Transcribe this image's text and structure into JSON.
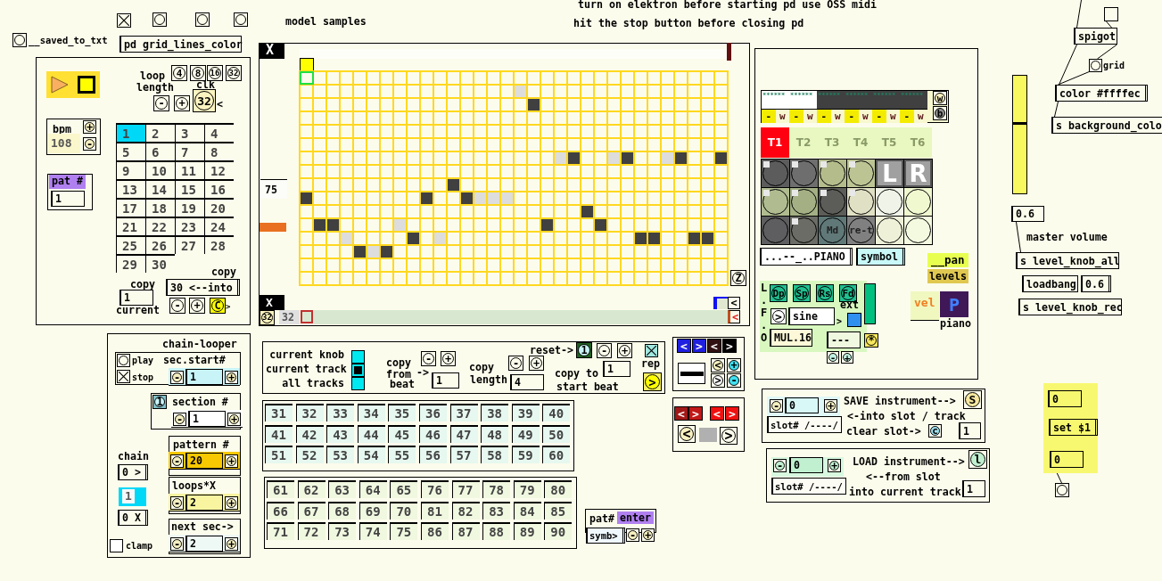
{
  "header": {
    "saved_label": "__saved_to_txt",
    "toggle_checked": true,
    "subpatch": "pd grid_lines_color"
  },
  "comments": [
    "model samples",
    "turn on elektron before starting pd use OSS midi",
    "hit the stop button before closing pd"
  ],
  "transport": {
    "loop_label": "loop",
    "length_label": "length",
    "loop_buttons": [
      "4",
      "8",
      "16",
      "32"
    ],
    "clk_label": "clk",
    "minus": "-",
    "plus": "+",
    "clk_value": "32",
    "clk_arrow": "<",
    "bpm_label": "bpm",
    "bpm_plus": "+",
    "bpm": "108",
    "bpm_minus": "-",
    "pat_label": "pat #",
    "pat_value": "1",
    "patterns": [
      {
        "label": "1",
        "selected": true
      },
      {
        "label": "2",
        "selected": false
      },
      {
        "label": "3",
        "selected": false
      },
      {
        "label": "4",
        "selected": false
      },
      {
        "label": "5",
        "selected": false
      },
      {
        "label": "6",
        "selected": false
      },
      {
        "label": "7",
        "selected": false
      },
      {
        "label": "8",
        "selected": false
      },
      {
        "label": "9",
        "selected": false
      },
      {
        "label": "10",
        "selected": false
      },
      {
        "label": "11",
        "selected": false
      },
      {
        "label": "12",
        "selected": false
      },
      {
        "label": "13",
        "selected": false
      },
      {
        "label": "14",
        "selected": false
      },
      {
        "label": "15",
        "selected": false
      },
      {
        "label": "16",
        "selected": false
      },
      {
        "label": "17",
        "selected": false
      },
      {
        "label": "18",
        "selected": false
      },
      {
        "label": "19",
        "selected": false
      },
      {
        "label": "20",
        "selected": false
      },
      {
        "label": "21",
        "selected": false
      },
      {
        "label": "22",
        "selected": false
      },
      {
        "label": "23",
        "selected": false
      },
      {
        "label": "24",
        "selected": false
      },
      {
        "label": "25",
        "selected": false
      },
      {
        "label": "26",
        "selected": false
      },
      {
        "label": "27",
        "selected": false
      },
      {
        "label": "28",
        "selected": false
      },
      {
        "label": "29",
        "selected": false
      },
      {
        "label": "30",
        "selected": false
      }
    ],
    "copy_label": "copy",
    "copy_value": "1",
    "current_label": "current",
    "into_label": "copy",
    "into_message": "30 <--into",
    "into_minus": "-",
    "into_plus": "+",
    "copy_button": "C",
    "copy_arrow": ">"
  },
  "chain_looper": {
    "title": "chain-looper",
    "play_label": "play",
    "stop_checked": true,
    "stop_label": "stop",
    "section_bang": "1",
    "steppers": [
      {
        "label": "sec.start#",
        "minus": "-",
        "value": "1",
        "plus": "+",
        "color": "#c8f4f8"
      },
      {
        "label": "section #",
        "minus": "-",
        "value": "1",
        "plus": "+",
        "color": "#ffffff"
      },
      {
        "label": "pattern #",
        "minus": "-",
        "value": "20",
        "plus": "+",
        "color": "#f8c800"
      },
      {
        "label": "loops*X",
        "minus": "-",
        "value": "2",
        "plus": "+",
        "color": "#f8f4a0"
      },
      {
        "label": "next sec->",
        "minus": "-",
        "value": "2",
        "plus": "+",
        "color": "#eef8f4"
      }
    ],
    "chain_label": "chain",
    "chain_in": "0 >",
    "chain_value": "1",
    "chain_out": "0 X",
    "clamp_label": "clamp",
    "clamp_checked": false
  },
  "sequencer": {
    "top_tab": "X",
    "level_value": "75",
    "bottom_tab": "X",
    "steps_knob": "32",
    "steps": "32",
    "zoom_button": "Z",
    "scroll_left": "<",
    "scroll_back": "<",
    "rows": [
      [
        {
          "kind": "off"
        },
        {
          "kind": "off"
        },
        {
          "kind": "off"
        },
        {
          "kind": "off"
        },
        {
          "kind": "off"
        },
        {
          "kind": "off"
        },
        {
          "kind": "off"
        },
        {
          "kind": "off"
        },
        {
          "kind": "off"
        },
        {
          "kind": "off"
        },
        {
          "kind": "off"
        },
        {
          "kind": "off"
        },
        {
          "kind": "off"
        },
        {
          "kind": "off"
        },
        {
          "kind": "off"
        },
        {
          "kind": "off"
        },
        {
          "kind": "off"
        },
        {
          "kind": "off"
        },
        {
          "kind": "off"
        },
        {
          "kind": "off"
        },
        {
          "kind": "off"
        },
        {
          "kind": "off"
        },
        {
          "kind": "off"
        },
        {
          "kind": "off"
        },
        {
          "kind": "off"
        },
        {
          "kind": "off"
        },
        {
          "kind": "off"
        },
        {
          "kind": "off"
        },
        {
          "kind": "off"
        },
        {
          "kind": "off"
        },
        {
          "kind": "off"
        },
        {
          "kind": "off"
        }
      ],
      [
        {
          "kind": "off"
        },
        {
          "kind": "off"
        },
        {
          "kind": "off"
        },
        {
          "kind": "off"
        },
        {
          "kind": "off"
        },
        {
          "kind": "off"
        },
        {
          "kind": "off"
        },
        {
          "kind": "off"
        },
        {
          "kind": "off"
        },
        {
          "kind": "off"
        },
        {
          "kind": "off"
        },
        {
          "kind": "off"
        },
        {
          "kind": "off"
        },
        {
          "kind": "off"
        },
        {
          "kind": "off"
        },
        {
          "kind": "off"
        },
        {
          "kind": "ghost"
        },
        {
          "kind": "off"
        },
        {
          "kind": "off"
        },
        {
          "kind": "off"
        },
        {
          "kind": "off"
        },
        {
          "kind": "off"
        },
        {
          "kind": "off"
        },
        {
          "kind": "off"
        },
        {
          "kind": "off"
        },
        {
          "kind": "off"
        },
        {
          "kind": "off"
        },
        {
          "kind": "off"
        },
        {
          "kind": "off"
        },
        {
          "kind": "off"
        },
        {
          "kind": "off"
        },
        {
          "kind": "off"
        }
      ],
      [
        {
          "kind": "off"
        },
        {
          "kind": "off"
        },
        {
          "kind": "off"
        },
        {
          "kind": "off"
        },
        {
          "kind": "off"
        },
        {
          "kind": "off"
        },
        {
          "kind": "off"
        },
        {
          "kind": "off"
        },
        {
          "kind": "off"
        },
        {
          "kind": "off"
        },
        {
          "kind": "off"
        },
        {
          "kind": "off"
        },
        {
          "kind": "off"
        },
        {
          "kind": "off"
        },
        {
          "kind": "off"
        },
        {
          "kind": "off"
        },
        {
          "kind": "off"
        },
        {
          "kind": "on"
        },
        {
          "kind": "off"
        },
        {
          "kind": "off"
        },
        {
          "kind": "off"
        },
        {
          "kind": "off"
        },
        {
          "kind": "off"
        },
        {
          "kind": "off"
        },
        {
          "kind": "off"
        },
        {
          "kind": "off"
        },
        {
          "kind": "off"
        },
        {
          "kind": "off"
        },
        {
          "kind": "off"
        },
        {
          "kind": "off"
        },
        {
          "kind": "off"
        },
        {
          "kind": "off"
        }
      ],
      [
        {
          "kind": "off"
        },
        {
          "kind": "off"
        },
        {
          "kind": "off"
        },
        {
          "kind": "off"
        },
        {
          "kind": "off"
        },
        {
          "kind": "off"
        },
        {
          "kind": "off"
        },
        {
          "kind": "off"
        },
        {
          "kind": "off"
        },
        {
          "kind": "off"
        },
        {
          "kind": "off"
        },
        {
          "kind": "off"
        },
        {
          "kind": "off"
        },
        {
          "kind": "off"
        },
        {
          "kind": "off"
        },
        {
          "kind": "off"
        },
        {
          "kind": "off"
        },
        {
          "kind": "off"
        },
        {
          "kind": "off"
        },
        {
          "kind": "off"
        },
        {
          "kind": "off"
        },
        {
          "kind": "off"
        },
        {
          "kind": "off"
        },
        {
          "kind": "off"
        },
        {
          "kind": "off"
        },
        {
          "kind": "off"
        },
        {
          "kind": "off"
        },
        {
          "kind": "off"
        },
        {
          "kind": "off"
        },
        {
          "kind": "off"
        },
        {
          "kind": "off"
        },
        {
          "kind": "off"
        }
      ],
      [
        {
          "kind": "off"
        },
        {
          "kind": "off"
        },
        {
          "kind": "off"
        },
        {
          "kind": "off"
        },
        {
          "kind": "off"
        },
        {
          "kind": "off"
        },
        {
          "kind": "off"
        },
        {
          "kind": "off"
        },
        {
          "kind": "off"
        },
        {
          "kind": "off"
        },
        {
          "kind": "off"
        },
        {
          "kind": "off"
        },
        {
          "kind": "off"
        },
        {
          "kind": "off"
        },
        {
          "kind": "off"
        },
        {
          "kind": "off"
        },
        {
          "kind": "off"
        },
        {
          "kind": "off"
        },
        {
          "kind": "off"
        },
        {
          "kind": "off"
        },
        {
          "kind": "off"
        },
        {
          "kind": "off"
        },
        {
          "kind": "off"
        },
        {
          "kind": "off"
        },
        {
          "kind": "off"
        },
        {
          "kind": "off"
        },
        {
          "kind": "off"
        },
        {
          "kind": "off"
        },
        {
          "kind": "off"
        },
        {
          "kind": "off"
        },
        {
          "kind": "off"
        },
        {
          "kind": "off"
        }
      ],
      [
        {
          "kind": "off"
        },
        {
          "kind": "off"
        },
        {
          "kind": "off"
        },
        {
          "kind": "off"
        },
        {
          "kind": "off"
        },
        {
          "kind": "off"
        },
        {
          "kind": "off"
        },
        {
          "kind": "off"
        },
        {
          "kind": "off"
        },
        {
          "kind": "off"
        },
        {
          "kind": "off"
        },
        {
          "kind": "off"
        },
        {
          "kind": "off"
        },
        {
          "kind": "off"
        },
        {
          "kind": "off"
        },
        {
          "kind": "off"
        },
        {
          "kind": "off"
        },
        {
          "kind": "off"
        },
        {
          "kind": "off"
        },
        {
          "kind": "off"
        },
        {
          "kind": "off"
        },
        {
          "kind": "off"
        },
        {
          "kind": "off"
        },
        {
          "kind": "off"
        },
        {
          "kind": "off"
        },
        {
          "kind": "off"
        },
        {
          "kind": "off"
        },
        {
          "kind": "off"
        },
        {
          "kind": "off"
        },
        {
          "kind": "off"
        },
        {
          "kind": "off"
        },
        {
          "kind": "off"
        }
      ],
      [
        {
          "kind": "off"
        },
        {
          "kind": "off"
        },
        {
          "kind": "off"
        },
        {
          "kind": "off"
        },
        {
          "kind": "off"
        },
        {
          "kind": "off"
        },
        {
          "kind": "off"
        },
        {
          "kind": "off"
        },
        {
          "kind": "off"
        },
        {
          "kind": "off"
        },
        {
          "kind": "off"
        },
        {
          "kind": "off"
        },
        {
          "kind": "off"
        },
        {
          "kind": "off"
        },
        {
          "kind": "off"
        },
        {
          "kind": "off"
        },
        {
          "kind": "off"
        },
        {
          "kind": "off"
        },
        {
          "kind": "off"
        },
        {
          "kind": "ghost"
        },
        {
          "kind": "on"
        },
        {
          "kind": "off"
        },
        {
          "kind": "off"
        },
        {
          "kind": "ghost"
        },
        {
          "kind": "on"
        },
        {
          "kind": "off"
        },
        {
          "kind": "off"
        },
        {
          "kind": "ghost"
        },
        {
          "kind": "on"
        },
        {
          "kind": "off"
        },
        {
          "kind": "off"
        },
        {
          "kind": "on"
        }
      ],
      [
        {
          "kind": "off"
        },
        {
          "kind": "off"
        },
        {
          "kind": "off"
        },
        {
          "kind": "off"
        },
        {
          "kind": "off"
        },
        {
          "kind": "off"
        },
        {
          "kind": "off"
        },
        {
          "kind": "off"
        },
        {
          "kind": "off"
        },
        {
          "kind": "off"
        },
        {
          "kind": "off"
        },
        {
          "kind": "off"
        },
        {
          "kind": "off"
        },
        {
          "kind": "off"
        },
        {
          "kind": "off"
        },
        {
          "kind": "off"
        },
        {
          "kind": "off"
        },
        {
          "kind": "off"
        },
        {
          "kind": "off"
        },
        {
          "kind": "off"
        },
        {
          "kind": "off"
        },
        {
          "kind": "off"
        },
        {
          "kind": "off"
        },
        {
          "kind": "off"
        },
        {
          "kind": "off"
        },
        {
          "kind": "off"
        },
        {
          "kind": "off"
        },
        {
          "kind": "off"
        },
        {
          "kind": "off"
        },
        {
          "kind": "off"
        },
        {
          "kind": "off"
        },
        {
          "kind": "off"
        }
      ],
      [
        {
          "kind": "off"
        },
        {
          "kind": "off"
        },
        {
          "kind": "off"
        },
        {
          "kind": "off"
        },
        {
          "kind": "off"
        },
        {
          "kind": "off"
        },
        {
          "kind": "off"
        },
        {
          "kind": "off"
        },
        {
          "kind": "off"
        },
        {
          "kind": "off"
        },
        {
          "kind": "off"
        },
        {
          "kind": "on"
        },
        {
          "kind": "off"
        },
        {
          "kind": "off"
        },
        {
          "kind": "off"
        },
        {
          "kind": "off"
        },
        {
          "kind": "off"
        },
        {
          "kind": "off"
        },
        {
          "kind": "off"
        },
        {
          "kind": "off"
        },
        {
          "kind": "off"
        },
        {
          "kind": "off"
        },
        {
          "kind": "off"
        },
        {
          "kind": "off"
        },
        {
          "kind": "off"
        },
        {
          "kind": "off"
        },
        {
          "kind": "off"
        },
        {
          "kind": "off"
        },
        {
          "kind": "off"
        },
        {
          "kind": "off"
        },
        {
          "kind": "off"
        },
        {
          "kind": "off"
        }
      ],
      [
        {
          "kind": "on"
        },
        {
          "kind": "off"
        },
        {
          "kind": "off"
        },
        {
          "kind": "off"
        },
        {
          "kind": "off"
        },
        {
          "kind": "off"
        },
        {
          "kind": "off"
        },
        {
          "kind": "off"
        },
        {
          "kind": "off"
        },
        {
          "kind": "on"
        },
        {
          "kind": "off"
        },
        {
          "kind": "off"
        },
        {
          "kind": "on"
        },
        {
          "kind": "ghost"
        },
        {
          "kind": "ghost"
        },
        {
          "kind": "ghost"
        },
        {
          "kind": "off"
        },
        {
          "kind": "off"
        },
        {
          "kind": "off"
        },
        {
          "kind": "off"
        },
        {
          "kind": "off"
        },
        {
          "kind": "off"
        },
        {
          "kind": "off"
        },
        {
          "kind": "off"
        },
        {
          "kind": "off"
        },
        {
          "kind": "off"
        },
        {
          "kind": "off"
        },
        {
          "kind": "off"
        },
        {
          "kind": "off"
        },
        {
          "kind": "off"
        },
        {
          "kind": "off"
        },
        {
          "kind": "off"
        }
      ],
      [
        {
          "kind": "off"
        },
        {
          "kind": "off"
        },
        {
          "kind": "off"
        },
        {
          "kind": "off"
        },
        {
          "kind": "off"
        },
        {
          "kind": "off"
        },
        {
          "kind": "off"
        },
        {
          "kind": "off"
        },
        {
          "kind": "off"
        },
        {
          "kind": "off"
        },
        {
          "kind": "off"
        },
        {
          "kind": "off"
        },
        {
          "kind": "off"
        },
        {
          "kind": "off"
        },
        {
          "kind": "off"
        },
        {
          "kind": "off"
        },
        {
          "kind": "off"
        },
        {
          "kind": "off"
        },
        {
          "kind": "off"
        },
        {
          "kind": "off"
        },
        {
          "kind": "off"
        },
        {
          "kind": "on"
        },
        {
          "kind": "off"
        },
        {
          "kind": "off"
        },
        {
          "kind": "off"
        },
        {
          "kind": "off"
        },
        {
          "kind": "off"
        },
        {
          "kind": "off"
        },
        {
          "kind": "off"
        },
        {
          "kind": "off"
        },
        {
          "kind": "off"
        },
        {
          "kind": "off"
        }
      ],
      [
        {
          "kind": "off"
        },
        {
          "kind": "on"
        },
        {
          "kind": "on"
        },
        {
          "kind": "off"
        },
        {
          "kind": "off"
        },
        {
          "kind": "off"
        },
        {
          "kind": "off"
        },
        {
          "kind": "ghost"
        },
        {
          "kind": "off"
        },
        {
          "kind": "off"
        },
        {
          "kind": "off"
        },
        {
          "kind": "off"
        },
        {
          "kind": "off"
        },
        {
          "kind": "off"
        },
        {
          "kind": "off"
        },
        {
          "kind": "off"
        },
        {
          "kind": "off"
        },
        {
          "kind": "off"
        },
        {
          "kind": "on"
        },
        {
          "kind": "off"
        },
        {
          "kind": "off"
        },
        {
          "kind": "off"
        },
        {
          "kind": "on"
        },
        {
          "kind": "off"
        },
        {
          "kind": "off"
        },
        {
          "kind": "off"
        },
        {
          "kind": "off"
        },
        {
          "kind": "off"
        },
        {
          "kind": "off"
        },
        {
          "kind": "off"
        },
        {
          "kind": "off"
        },
        {
          "kind": "off"
        }
      ],
      [
        {
          "kind": "off"
        },
        {
          "kind": "off"
        },
        {
          "kind": "off"
        },
        {
          "kind": "ghost"
        },
        {
          "kind": "off"
        },
        {
          "kind": "off"
        },
        {
          "kind": "off"
        },
        {
          "kind": "off"
        },
        {
          "kind": "on"
        },
        {
          "kind": "off"
        },
        {
          "kind": "ghost"
        },
        {
          "kind": "off"
        },
        {
          "kind": "off"
        },
        {
          "kind": "off"
        },
        {
          "kind": "off"
        },
        {
          "kind": "off"
        },
        {
          "kind": "off"
        },
        {
          "kind": "off"
        },
        {
          "kind": "off"
        },
        {
          "kind": "off"
        },
        {
          "kind": "off"
        },
        {
          "kind": "off"
        },
        {
          "kind": "off"
        },
        {
          "kind": "off"
        },
        {
          "kind": "off"
        },
        {
          "kind": "on"
        },
        {
          "kind": "on"
        },
        {
          "kind": "off"
        },
        {
          "kind": "off"
        },
        {
          "kind": "on"
        },
        {
          "kind": "on"
        },
        {
          "kind": "off"
        }
      ],
      [
        {
          "kind": "off"
        },
        {
          "kind": "off"
        },
        {
          "kind": "off"
        },
        {
          "kind": "off"
        },
        {
          "kind": "on"
        },
        {
          "kind": "ghost"
        },
        {
          "kind": "on"
        },
        {
          "kind": "off"
        },
        {
          "kind": "off"
        },
        {
          "kind": "off"
        },
        {
          "kind": "off"
        },
        {
          "kind": "off"
        },
        {
          "kind": "off"
        },
        {
          "kind": "off"
        },
        {
          "kind": "off"
        },
        {
          "kind": "off"
        },
        {
          "kind": "off"
        },
        {
          "kind": "off"
        },
        {
          "kind": "off"
        },
        {
          "kind": "off"
        },
        {
          "kind": "off"
        },
        {
          "kind": "off"
        },
        {
          "kind": "off"
        },
        {
          "kind": "off"
        },
        {
          "kind": "off"
        },
        {
          "kind": "off"
        },
        {
          "kind": "off"
        },
        {
          "kind": "off"
        },
        {
          "kind": "off"
        },
        {
          "kind": "off"
        },
        {
          "kind": "off"
        },
        {
          "kind": "off"
        }
      ],
      [
        {
          "kind": "off"
        },
        {
          "kind": "off"
        },
        {
          "kind": "off"
        },
        {
          "kind": "off"
        },
        {
          "kind": "off"
        },
        {
          "kind": "off"
        },
        {
          "kind": "off"
        },
        {
          "kind": "off"
        },
        {
          "kind": "off"
        },
        {
          "kind": "off"
        },
        {
          "kind": "off"
        },
        {
          "kind": "off"
        },
        {
          "kind": "off"
        },
        {
          "kind": "off"
        },
        {
          "kind": "off"
        },
        {
          "kind": "off"
        },
        {
          "kind": "off"
        },
        {
          "kind": "off"
        },
        {
          "kind": "off"
        },
        {
          "kind": "off"
        },
        {
          "kind": "off"
        },
        {
          "kind": "off"
        },
        {
          "kind": "off"
        },
        {
          "kind": "off"
        },
        {
          "kind": "off"
        },
        {
          "kind": "off"
        },
        {
          "kind": "off"
        },
        {
          "kind": "off"
        },
        {
          "kind": "off"
        },
        {
          "kind": "off"
        },
        {
          "kind": "off"
        },
        {
          "kind": "off"
        }
      ],
      [
        {
          "kind": "off"
        },
        {
          "kind": "off"
        },
        {
          "kind": "off"
        },
        {
          "kind": "off"
        },
        {
          "kind": "off"
        },
        {
          "kind": "off"
        },
        {
          "kind": "off"
        },
        {
          "kind": "off"
        },
        {
          "kind": "off"
        },
        {
          "kind": "off"
        },
        {
          "kind": "off"
        },
        {
          "kind": "off"
        },
        {
          "kind": "off"
        },
        {
          "kind": "off"
        },
        {
          "kind": "off"
        },
        {
          "kind": "off"
        },
        {
          "kind": "off"
        },
        {
          "kind": "off"
        },
        {
          "kind": "off"
        },
        {
          "kind": "off"
        },
        {
          "kind": "off"
        },
        {
          "kind": "off"
        },
        {
          "kind": "off"
        },
        {
          "kind": "off"
        },
        {
          "kind": "off"
        },
        {
          "kind": "off"
        },
        {
          "kind": "off"
        },
        {
          "kind": "off"
        },
        {
          "kind": "off"
        },
        {
          "kind": "off"
        },
        {
          "kind": "off"
        },
        {
          "kind": "off"
        }
      ]
    ]
  },
  "copy_panel": {
    "modes": [
      {
        "label": "current knob",
        "selected": false
      },
      {
        "label": "current track",
        "selected": true
      },
      {
        "label": "all tracks",
        "selected": false
      }
    ],
    "from_label": "copy",
    "from_label2": "from",
    "from_arrow": "->",
    "from_label3": "beat",
    "from_value": "1",
    "from_minus": "-",
    "from_plus": "+",
    "length_label": "copy",
    "length_label2": "length",
    "length_value": "4",
    "length_minus": "-",
    "length_plus": "+",
    "reset_label": "reset->",
    "reset_value": "1",
    "reset_minus": "-",
    "reset_plus": "+",
    "to_label": "copy to",
    "to_label2": "start beat",
    "to_value": "1",
    "rep_checked": true,
    "rep_label": "rep",
    "go_button": ">"
  },
  "number_banks": [
    [
      "31",
      "32",
      "33",
      "34",
      "35",
      "36",
      "37",
      "38",
      "39",
      "40",
      "41",
      "42",
      "43",
      "44",
      "45",
      "46",
      "47",
      "48",
      "49",
      "50",
      "51",
      "52",
      "53",
      "54",
      "55",
      "56",
      "57",
      "58",
      "59",
      "60"
    ],
    [
      "61",
      "62",
      "63",
      "64",
      "65",
      "76",
      "77",
      "78",
      "79",
      "80",
      "66",
      "67",
      "68",
      "69",
      "70",
      "81",
      "82",
      "83",
      "84",
      "85",
      "71",
      "72",
      "73",
      "74",
      "75",
      "86",
      "87",
      "88",
      "89",
      "90"
    ]
  ],
  "nav": {
    "arrows": [
      {
        "label": "<",
        "color": "#2020e0"
      },
      {
        "label": ">",
        "color": "#2020e0"
      },
      {
        "label": "<",
        "color": "#301010"
      },
      {
        "label": ">",
        "color": "#000000"
      }
    ],
    "steps": [
      {
        "label": "<",
        "color": "#f8f4c0"
      },
      {
        "label": "+",
        "color": "#40e0f0"
      },
      {
        "label": ">",
        "color": "#ffffff"
      },
      {
        "label": "-",
        "color": "#40e0f0"
      }
    ]
  },
  "nav2": {
    "arrows": [
      {
        "label": "<",
        "color": "#a01818"
      },
      {
        "label": ">",
        "color": "#c01818"
      },
      {
        "label": "<",
        "color": "#f01010"
      },
      {
        "label": ">",
        "color": "#f01010"
      }
    ],
    "prev": "<",
    "next": ">"
  },
  "pat_entry": {
    "label": "pat#",
    "enter": "enter",
    "symbol": "symb>",
    "minus": "-",
    "plus": "+"
  },
  "instrument": {
    "meters": [
      {
        "label": "******",
        "dark": false,
        "minus": "-",
        "mode": "w"
      },
      {
        "label": "******",
        "dark": false,
        "minus": "-",
        "mode": "w"
      },
      {
        "label": "******",
        "dark": true,
        "minus": "-",
        "mode": "w"
      },
      {
        "label": "******",
        "dark": true,
        "minus": "-",
        "mode": "w"
      },
      {
        "label": "******",
        "dark": true,
        "minus": "-",
        "mode": "w"
      },
      {
        "label": "******",
        "dark": true,
        "minus": "-",
        "mode": "w"
      }
    ],
    "meter_buttons": [
      "w",
      "b"
    ],
    "tracks": [
      {
        "label": "T1",
        "selected": true
      },
      {
        "label": "T2",
        "selected": false
      },
      {
        "label": "T3",
        "selected": false
      },
      {
        "label": "T4",
        "selected": false
      },
      {
        "label": "T5",
        "selected": false
      },
      {
        "label": "T6",
        "selected": false
      }
    ],
    "knobs": [
      {
        "kind": "knob",
        "color": "#5c5c5c",
        "marker": true
      },
      {
        "kind": "knob",
        "color": "#6e6e6e",
        "marker": true
      },
      {
        "kind": "knob",
        "color": "#b4bc8c",
        "marker": true
      },
      {
        "kind": "knob",
        "color": "#bcc494",
        "marker": true
      },
      {
        "kind": "letter",
        "label": "L"
      },
      {
        "kind": "letter",
        "label": "R"
      },
      {
        "kind": "knob",
        "color": "#b0bc90",
        "marker": true
      },
      {
        "kind": "knob",
        "color": "#a4b084",
        "marker": true
      },
      {
        "kind": "knob",
        "color": "#5c5c58",
        "marker": true
      },
      {
        "kind": "knob",
        "color": "#e0e0c4",
        "marker": true
      },
      {
        "kind": "knob",
        "color": "#f0f4e8",
        "marker": false
      },
      {
        "kind": "knob",
        "color": "#f0f8d0",
        "marker": false
      },
      {
        "kind": "knob",
        "color": "#5e5e60",
        "marker": false
      },
      {
        "kind": "knob",
        "color": "#6c6c66",
        "marker": true
      },
      {
        "kind": "knob",
        "color": "#607878",
        "marker": false,
        "label": "Md"
      },
      {
        "kind": "knob",
        "color": "#808080",
        "marker": false,
        "label": "re-t"
      },
      {
        "kind": "knob",
        "color": "#eef0d8",
        "marker": false
      },
      {
        "kind": "knob",
        "color": "#f4fae0",
        "marker": false
      }
    ],
    "preset": "...--_..PIANO",
    "symbol": "symbol",
    "pan": "__pan",
    "levels": "levels",
    "lfo": {
      "letters": [
        "L",
        ".",
        "F",
        ".",
        "O"
      ],
      "buttons": [
        "Dp",
        "Sp",
        "Rs",
        "Fd"
      ],
      "wave_button": ">",
      "wave": "sine",
      "arrow": ">",
      "ext_label": "ext",
      "mul": "MUL.16",
      "value": "---",
      "star": "*",
      "minus": "-",
      "plus": "+"
    },
    "vel": "vel",
    "p_button": "P",
    "p_label": "piano"
  },
  "save": {
    "minus": "-",
    "slot": "0",
    "plus": "+",
    "slot_label": "slot# /----/",
    "title": "SAVE instrument-->",
    "button": "S",
    "line2": "<-into slot / track",
    "clear_label": "clear slot->",
    "clear_button": "c",
    "track": "1"
  },
  "load": {
    "minus": "-",
    "slot": "0",
    "plus": "+",
    "slot_label": "slot# /----/",
    "title": "LOAD instrument-->",
    "button": "l",
    "line2": "<--from slot",
    "line3": "into current track",
    "track": "1"
  },
  "right": {
    "spigot": "spigot",
    "grid_label": "grid",
    "color_msg": "color #ffffec",
    "send_bg": "s background_colo",
    "volume": {
      "level": 0.6,
      "value": "0.6",
      "label": "master volume"
    },
    "send_all": "s level_knob_all",
    "loadbang": "loadbang",
    "init": "0.6",
    "send_rec": "s level_knob_rec",
    "set_box": {
      "in": "0",
      "msg": "set $1",
      "out": "0"
    }
  }
}
